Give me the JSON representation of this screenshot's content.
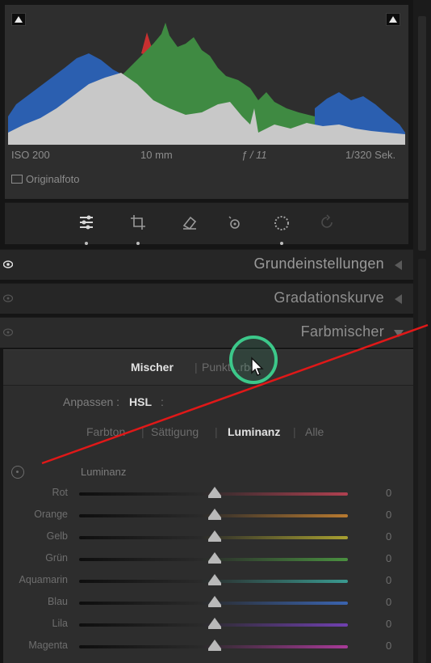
{
  "histogram": {
    "iso": "ISO 200",
    "focal_length": "10 mm",
    "aperture": "ƒ / 11",
    "shutter": "1/320 Sek.",
    "original_photo_label": "Originalfoto"
  },
  "tools": [
    "edit-sliders-icon",
    "crop-icon",
    "eraser-icon",
    "redeye-icon",
    "mask-icon",
    "preset-icon"
  ],
  "sections": {
    "grundeinstellungen": "Grundeinstellungen",
    "gradationskurve": "Gradationskurve",
    "farbmischer": "Farbmischer"
  },
  "mixer": {
    "tabs": {
      "mischer": "Mischer",
      "separator": "|",
      "punkt": "Punkt...rbe"
    },
    "adjust_label": "Anpassen :",
    "adjust_value": "HSL",
    "adjust_caret": ":",
    "subtabs": {
      "farbton": "Farbton",
      "sattigung": "Sättigung",
      "luminanz": "Luminanz",
      "alle": "Alle",
      "separator": "|"
    },
    "group_label": "Luminanz",
    "sliders": [
      {
        "label": "Rot",
        "value": "0",
        "color": "#b04050"
      },
      {
        "label": "Orange",
        "value": "0",
        "color": "#b87a30"
      },
      {
        "label": "Gelb",
        "value": "0",
        "color": "#a8a030"
      },
      {
        "label": "Grün",
        "value": "0",
        "color": "#4a9040"
      },
      {
        "label": "Aquamarin",
        "value": "0",
        "color": "#3a9a90"
      },
      {
        "label": "Blau",
        "value": "0",
        "color": "#3a64b0"
      },
      {
        "label": "Lila",
        "value": "0",
        "color": "#7040b0"
      },
      {
        "label": "Magenta",
        "value": "0",
        "color": "#a83a98"
      }
    ]
  },
  "colors": {
    "accent_ring": "#3cc88a",
    "annotation_line": "#e01818"
  }
}
